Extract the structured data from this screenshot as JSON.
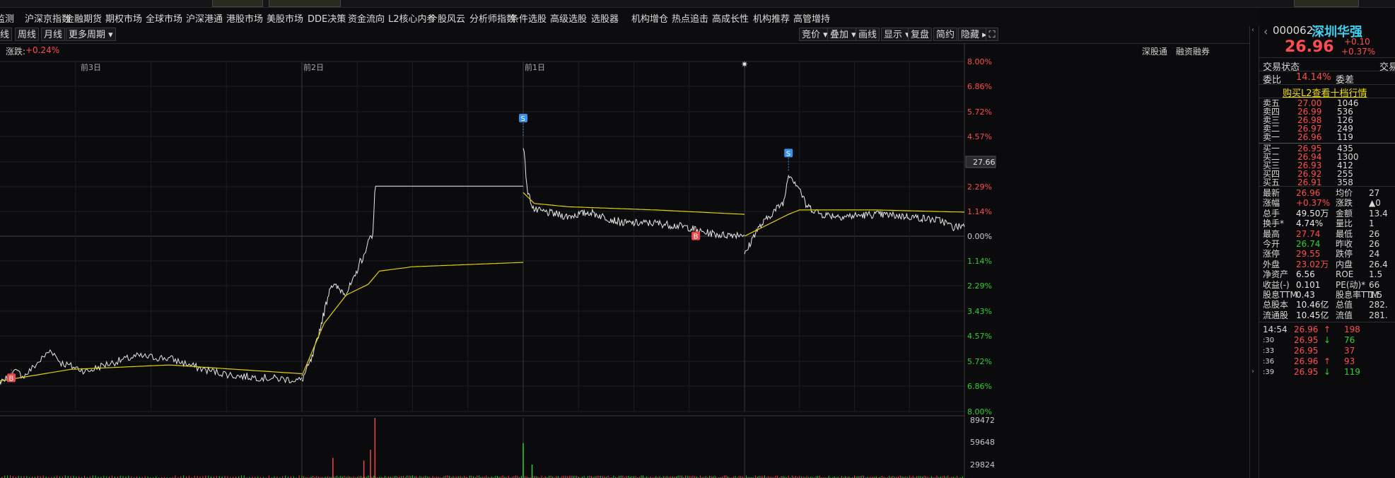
{
  "top_menu": [
    "监测",
    "沪深京指数",
    "金融期货",
    "期权市场",
    "全球市场",
    "沪深港通",
    "港股市场",
    "美股市场",
    "DDE决策",
    "资金流向",
    "L2核心内参",
    "个股风云",
    "分析师指数",
    "条件选股",
    "高级选股",
    "选股器",
    "机构增仓",
    "热点追击",
    "高成长性",
    "机构推荐",
    "高管增持"
  ],
  "period_bar": {
    "left": [
      "线",
      "周线",
      "月线",
      "更多周期"
    ],
    "right": [
      "竞价",
      "叠加",
      "画线",
      "显示",
      "复盘",
      "简约",
      "隐藏"
    ]
  },
  "info": {
    "change_label": "涨跌",
    "change_value": "+0.24%",
    "tag1": "深股通",
    "tag2": "融资融券"
  },
  "chart_data": {
    "type": "line",
    "sessions": [
      "前3日",
      "前2日",
      "前1日",
      ""
    ],
    "pct_axis_top": [
      "8.00%",
      "6.86%",
      "5.72%",
      "4.57%",
      "3.43%",
      "2.29%",
      "1.14%",
      "0.00%"
    ],
    "pct_axis_bottom": [
      "1.14%",
      "2.29%",
      "3.43%",
      "4.57%",
      "5.72%",
      "6.86%",
      "8.00%"
    ],
    "price_marker": "27.66",
    "volume_axis": [
      "89472",
      "59648",
      "29824"
    ],
    "markers": [
      {
        "label": "B",
        "session": 0,
        "t": 0.12,
        "pct": -6.1
      },
      {
        "label": "S",
        "session": 2,
        "t": 0.0,
        "pct": 4.6
      },
      {
        "label": "B",
        "session": 2,
        "t": 0.78,
        "pct": 0.4
      },
      {
        "label": "S",
        "session": 3,
        "t": 0.2,
        "pct": 3.0
      }
    ],
    "price_keypoints": [
      [
        [
          0,
          -6.6
        ],
        [
          0.05,
          -6.8
        ],
        [
          0.11,
          -6.5
        ],
        [
          0.13,
          -6.2
        ],
        [
          0.16,
          -6.4
        ],
        [
          0.24,
          -5.2
        ],
        [
          0.27,
          -5.8
        ],
        [
          0.35,
          -6.2
        ],
        [
          0.4,
          -5.9
        ],
        [
          0.5,
          -5.5
        ],
        [
          0.6,
          -5.6
        ],
        [
          0.7,
          -6.1
        ],
        [
          0.8,
          -6.4
        ],
        [
          0.9,
          -6.5
        ],
        [
          1,
          -6.6
        ]
      ],
      [
        [
          0,
          -6.6
        ],
        [
          0.05,
          -5.5
        ],
        [
          0.1,
          -3.5
        ],
        [
          0.13,
          -2.2
        ],
        [
          0.2,
          -2.6
        ],
        [
          0.24,
          -1.9
        ],
        [
          0.26,
          -1.2
        ],
        [
          0.29,
          -0.8
        ],
        [
          0.3,
          0
        ],
        [
          0.32,
          -0.1
        ],
        [
          0.33,
          2.29
        ],
        [
          1,
          2.29
        ]
      ],
      [
        [
          0,
          4.2
        ],
        [
          0.02,
          2.0
        ],
        [
          0.05,
          1.2
        ],
        [
          0.1,
          1.1
        ],
        [
          0.2,
          0.9
        ],
        [
          0.3,
          1.1
        ],
        [
          0.45,
          0.6
        ],
        [
          0.6,
          0.6
        ],
        [
          0.75,
          0.4
        ],
        [
          0.8,
          0.2
        ],
        [
          0.9,
          0.05
        ],
        [
          1,
          0.1
        ]
      ],
      [
        [
          0,
          -0.9
        ],
        [
          0.05,
          0.2
        ],
        [
          0.12,
          1.0
        ],
        [
          0.18,
          1.6
        ],
        [
          0.2,
          2.9
        ],
        [
          0.25,
          2.2
        ],
        [
          0.28,
          1.4
        ],
        [
          0.35,
          1.0
        ],
        [
          0.45,
          0.9
        ],
        [
          0.6,
          1.0
        ],
        [
          0.75,
          0.9
        ],
        [
          0.9,
          0.7
        ],
        [
          0.95,
          0.4
        ],
        [
          1,
          0.5
        ]
      ]
    ],
    "avg_keypoints": [
      [
        [
          0,
          -6.8
        ],
        [
          0.1,
          -6.6
        ],
        [
          0.3,
          -6.1
        ],
        [
          0.6,
          -5.9
        ],
        [
          1,
          -6.3
        ]
      ],
      [
        [
          0,
          -6.4
        ],
        [
          0.1,
          -4.0
        ],
        [
          0.2,
          -2.7
        ],
        [
          0.3,
          -2.2
        ],
        [
          0.35,
          -1.6
        ],
        [
          0.5,
          -1.4
        ],
        [
          1,
          -1.2
        ]
      ],
      [
        [
          0,
          2.0
        ],
        [
          0.05,
          1.5
        ],
        [
          0.2,
          1.35
        ],
        [
          0.6,
          1.2
        ],
        [
          1,
          1.0
        ]
      ],
      [
        [
          0,
          0.0
        ],
        [
          0.1,
          0.5
        ],
        [
          0.2,
          1.0
        ],
        [
          0.25,
          1.2
        ],
        [
          0.6,
          1.2
        ],
        [
          1,
          1.1
        ]
      ]
    ],
    "volume_spikes": [
      {
        "session": 1,
        "t": 0.33,
        "value": 89472
      },
      {
        "session": 1,
        "t": 0.31,
        "value": 42000
      },
      {
        "session": 1,
        "t": 0.14,
        "value": 30000
      },
      {
        "session": 1,
        "t": 0.28,
        "value": 26000
      },
      {
        "session": 2,
        "t": 0.0,
        "value": 52000
      },
      {
        "session": 2,
        "t": 0.04,
        "value": 20000
      }
    ]
  },
  "right_panel": {
    "code": "000062",
    "name": "深圳华强",
    "price": "26.96",
    "change_abs": "+0.10",
    "change_pct": "+0.37%",
    "trade_status_label": "交易状态",
    "trade_status_right": "交易",
    "weibi_label": "委比",
    "weibi_value": "14.14%",
    "weicha_label": "委差",
    "buy_l2": "购买L2查看十档行情",
    "asks": [
      {
        "label": "卖五",
        "price": "27.00",
        "vol": "1046"
      },
      {
        "label": "卖四",
        "price": "26.99",
        "vol": "536"
      },
      {
        "label": "卖三",
        "price": "26.98",
        "vol": "126"
      },
      {
        "label": "卖二",
        "price": "26.97",
        "vol": "249"
      },
      {
        "label": "卖一",
        "price": "26.96",
        "vol": "119"
      }
    ],
    "bids": [
      {
        "label": "买一",
        "price": "26.95",
        "vol": "435"
      },
      {
        "label": "买二",
        "price": "26.94",
        "vol": "1300"
      },
      {
        "label": "买三",
        "price": "26.93",
        "vol": "412"
      },
      {
        "label": "买四",
        "price": "26.92",
        "vol": "255"
      },
      {
        "label": "买五",
        "price": "26.91",
        "vol": "358"
      }
    ],
    "stats": [
      {
        "l1": "最新",
        "v1": "26.96",
        "c1": "red",
        "l2": "均价",
        "v2": "27"
      },
      {
        "l1": "涨幅",
        "v1": "+0.37%",
        "c1": "red",
        "l2": "涨跌",
        "v2": "▲0"
      },
      {
        "l1": "总手",
        "v1": "49.50万",
        "c1": "white",
        "l2": "金额",
        "v2": "13.4"
      },
      {
        "l1": "换手*",
        "v1": "4.74%",
        "c1": "white",
        "l2": "量比",
        "v2": "1"
      },
      {
        "l1": "最高",
        "v1": "27.74",
        "c1": "red",
        "l2": "最低",
        "v2": "26"
      },
      {
        "l1": "今开",
        "v1": "26.74",
        "c1": "green",
        "l2": "昨收",
        "v2": "26"
      },
      {
        "l1": "涨停",
        "v1": "29.55",
        "c1": "red",
        "l2": "跌停",
        "v2": "24"
      },
      {
        "l1": "外盘",
        "v1": "23.02万",
        "c1": "red",
        "l2": "内盘",
        "v2": "26.4"
      },
      {
        "l1": "净资产",
        "v1": "6.56",
        "c1": "white",
        "l2": "ROE",
        "v2": "1.5"
      },
      {
        "l1": "收益(-)",
        "v1": "0.101",
        "c1": "white",
        "l2": "PE(动)*",
        "v2": "66"
      },
      {
        "l1": "股息TTM",
        "v1": "0.43",
        "c1": "white",
        "l2": "股息率TTM",
        "v2": "1.5"
      },
      {
        "l1": "总股本",
        "v1": "10.46亿",
        "c1": "white",
        "l2": "总值",
        "v2": "282."
      },
      {
        "l1": "流通股",
        "v1": "10.45亿",
        "c1": "white",
        "l2": "流值",
        "v2": "281."
      }
    ],
    "ticks": [
      {
        "time": "14:54",
        "price": "26.96",
        "dir": "up",
        "vol": "198"
      },
      {
        "time": ":30",
        "price": "26.95",
        "dir": "down",
        "vol": "76"
      },
      {
        "time": ":33",
        "price": "26.95",
        "dir": "",
        "vol": "37"
      },
      {
        "time": ":36",
        "price": "26.96",
        "dir": "up",
        "vol": "93"
      },
      {
        "time": ":39",
        "price": "26.95",
        "dir": "down",
        "vol": "119"
      }
    ]
  }
}
